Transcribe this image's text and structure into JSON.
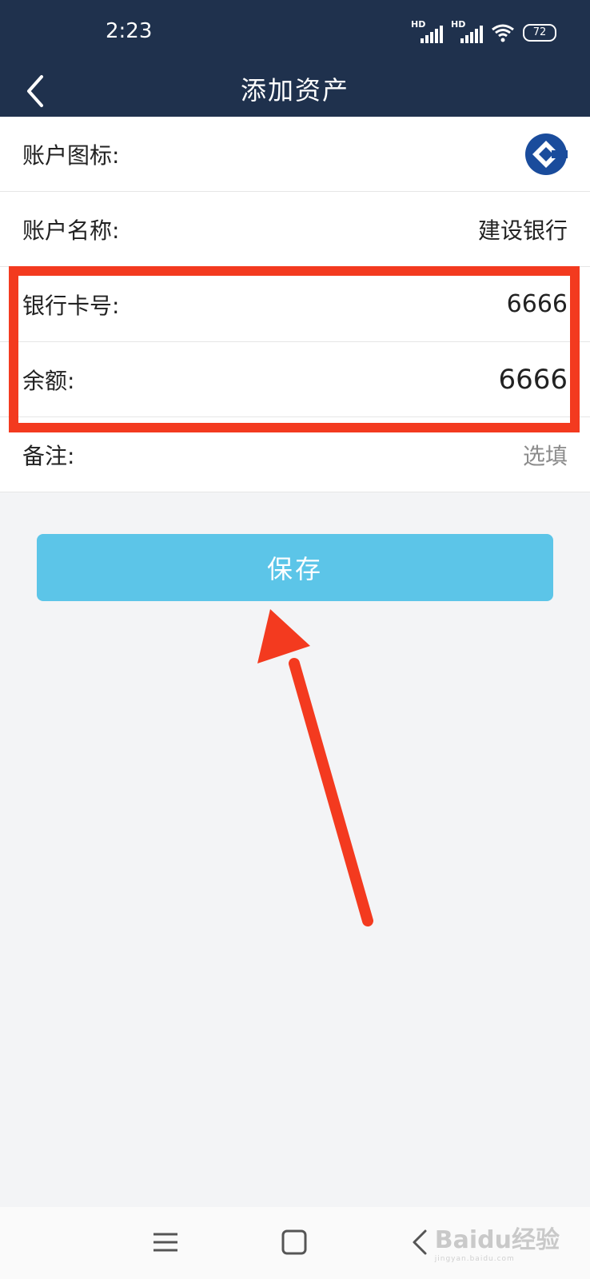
{
  "status_bar": {
    "time": "2:23",
    "signal_1_label": "HD",
    "signal_2_label": "HD",
    "battery": "72"
  },
  "header": {
    "title": "添加资产",
    "back_icon": "chevron-left-icon"
  },
  "form": {
    "rows": [
      {
        "label": "账户图标:",
        "value": "",
        "icon": "ccb-bank-logo"
      },
      {
        "label": "账户名称:",
        "value": "建设银行"
      },
      {
        "label": "银行卡号:",
        "value": "6666"
      },
      {
        "label": "余额:",
        "value": "6666"
      },
      {
        "label": "备注:",
        "placeholder": "选填"
      }
    ]
  },
  "save_button": {
    "label": "保存"
  },
  "colors": {
    "header_bg": "#1f314d",
    "accent_button": "#5cc5e8",
    "annotation_red": "#f33a1f",
    "bank_logo_blue": "#1a4c9c"
  },
  "system_nav": {
    "menu_icon": "menu-icon",
    "home_icon": "square-home-icon",
    "back_icon": "back-triangle-icon"
  },
  "watermark": {
    "brand": "Baidu经验",
    "url": "jingyan.baidu.com"
  }
}
